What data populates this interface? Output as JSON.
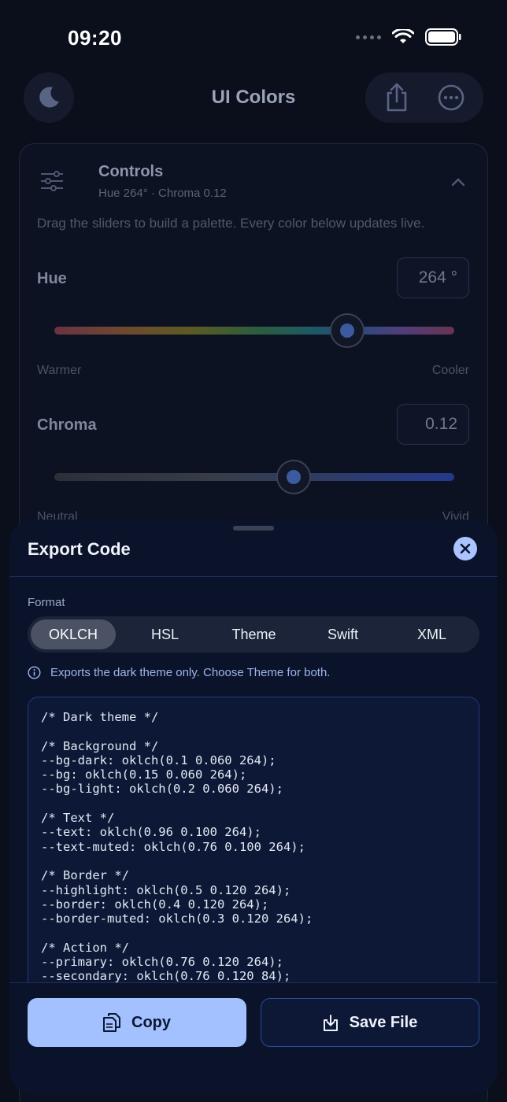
{
  "status_bar": {
    "time": "09:20"
  },
  "nav": {
    "title": "UI Colors"
  },
  "controls": {
    "title": "Controls",
    "subtitle": "Hue 264°  ·  Chroma 0.12",
    "description": "Drag the sliders to build a palette. Every color below updates live.",
    "hue": {
      "label": "Hue",
      "value_text": "264 °",
      "value": 264,
      "min_label": "Warmer",
      "max_label": "Cooler",
      "position_fraction": 0.733
    },
    "chroma": {
      "label": "Chroma",
      "value_text": "0.12",
      "value": 0.12,
      "min_label": "Neutral",
      "max_label": "Vivid",
      "position_fraction": 0.6
    }
  },
  "sheet": {
    "title": "Export Code",
    "format_label": "Format",
    "formats": [
      "OKLCH",
      "HSL",
      "Theme",
      "Swift",
      "XML"
    ],
    "selected_format": "OKLCH",
    "info_text": "Exports the dark theme only. Choose Theme for both.",
    "code_lines": [
      "/* Dark theme */",
      "",
      "/* Background */",
      "--bg-dark: oklch(0.1 0.060 264);",
      "--bg: oklch(0.15 0.060 264);",
      "--bg-light: oklch(0.2 0.060 264);",
      "",
      "/* Text */",
      "--text: oklch(0.96 0.100 264);",
      "--text-muted: oklch(0.76 0.100 264);",
      "",
      "/* Border */",
      "--highlight: oklch(0.5 0.120 264);",
      "--border: oklch(0.4 0.120 264);",
      "--border-muted: oklch(0.3 0.120 264);",
      "",
      "/* Action */",
      "--primary: oklch(0.76 0.120 264);",
      "--secondary: oklch(0.76 0.120 84);"
    ],
    "copy_label": "Copy",
    "save_label": "Save File"
  },
  "colors": {
    "accent": "#a3c1ff",
    "background": "#0b0f1c",
    "sheet": "#0a132a"
  },
  "icons": [
    "moon-icon",
    "share-icon",
    "more-icon",
    "sliders-icon",
    "chevron-up-icon",
    "close-icon",
    "info-icon",
    "copy-icon",
    "download-icon",
    "wifi-icon",
    "battery-icon"
  ]
}
